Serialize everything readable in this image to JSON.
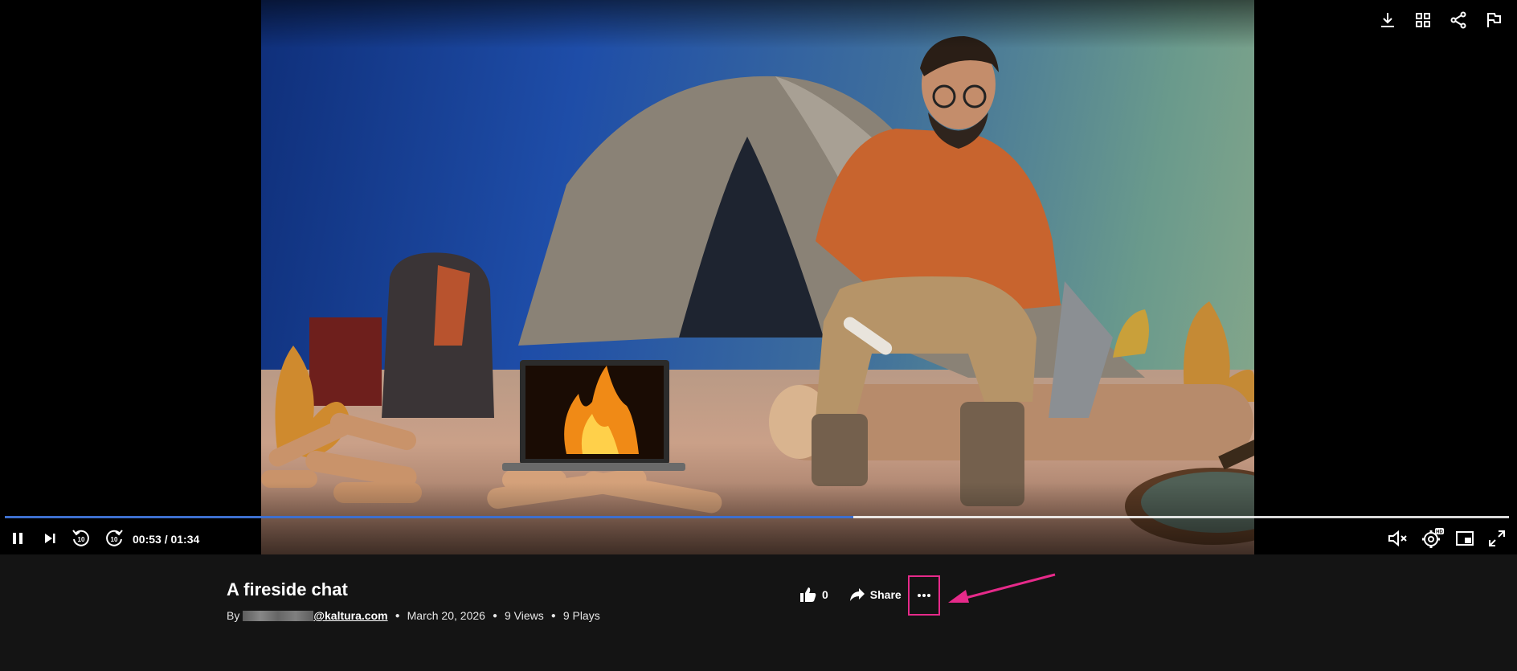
{
  "player": {
    "top_tools": [
      {
        "icon": "download-icon",
        "label": "Download"
      },
      {
        "icon": "grid-icon",
        "label": "Related"
      },
      {
        "icon": "share-icon",
        "label": "Share"
      },
      {
        "icon": "flag-icon",
        "label": "Report"
      }
    ],
    "time_display": "00:53 / 01:34",
    "progress_fraction": 0.564,
    "controls_left": [
      "pause-icon",
      "next-icon",
      "rewind-10-icon",
      "forward-10-icon"
    ],
    "controls_right": [
      "mute-icon",
      "settings-icon",
      "picture-in-picture-icon",
      "fullscreen-icon"
    ],
    "rewind_label": "10",
    "forward_label": "10",
    "settings_badge": "HD",
    "progress_color": "#3d6fcf"
  },
  "media": {
    "title": "A fireside chat",
    "by_label": "By",
    "owner_suffix": "@kaltura.com",
    "date": "March 20, 2026",
    "views": "9 Views",
    "plays": "9 Plays"
  },
  "actions": {
    "like_count": "0",
    "share_label": "Share",
    "more_icon": "more-options-icon",
    "highlight_color": "#e62a8a"
  }
}
